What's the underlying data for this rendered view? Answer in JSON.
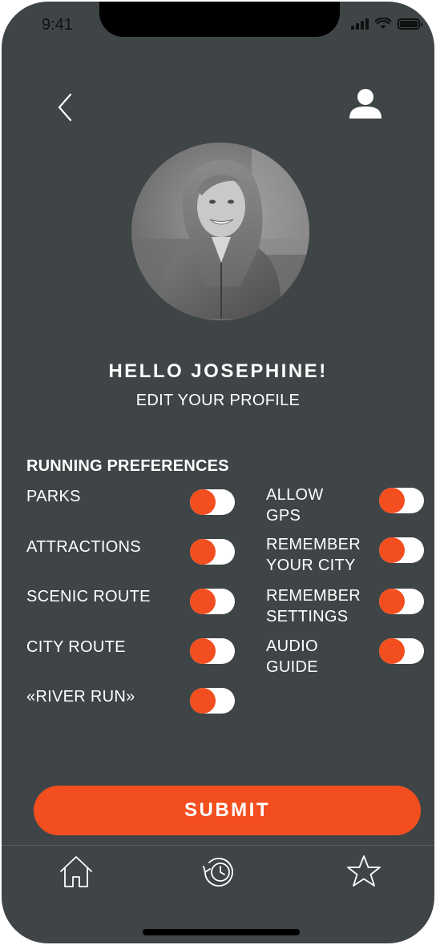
{
  "status_bar": {
    "time": "9:41"
  },
  "header": {
    "back_icon": "chevron-left-icon",
    "profile_icon": "user-icon"
  },
  "profile": {
    "avatar": "profile-photo",
    "greeting": "HELLO JOSEPHINE!",
    "subtitle": "EDIT YOUR PROFILE"
  },
  "preferences": {
    "title": "RUNNING PREFERENCES",
    "left": [
      {
        "label": "PARKS",
        "on": true
      },
      {
        "label": "ATTRACTIONS",
        "on": true
      },
      {
        "label": "SCENIC ROUTE",
        "on": true
      },
      {
        "label": "CITY ROUTE",
        "on": true
      },
      {
        "label": "«RIVER RUN»",
        "on": true
      }
    ],
    "right": [
      {
        "label": "ALLOW\nGPS",
        "on": true
      },
      {
        "label": "REMEMBER\nYOUR CITY",
        "on": true
      },
      {
        "label": "REMEMBER\nSETTINGS",
        "on": true
      },
      {
        "label": "AUDIO\nGUIDE",
        "on": true
      }
    ]
  },
  "actions": {
    "submit_label": "SUBMIT"
  },
  "tabbar": {
    "items": [
      {
        "icon": "home-icon"
      },
      {
        "icon": "history-icon"
      },
      {
        "icon": "star-icon"
      }
    ]
  },
  "colors": {
    "background": "#3f4446",
    "accent": "#f34e1f",
    "text": "#ffffff"
  }
}
